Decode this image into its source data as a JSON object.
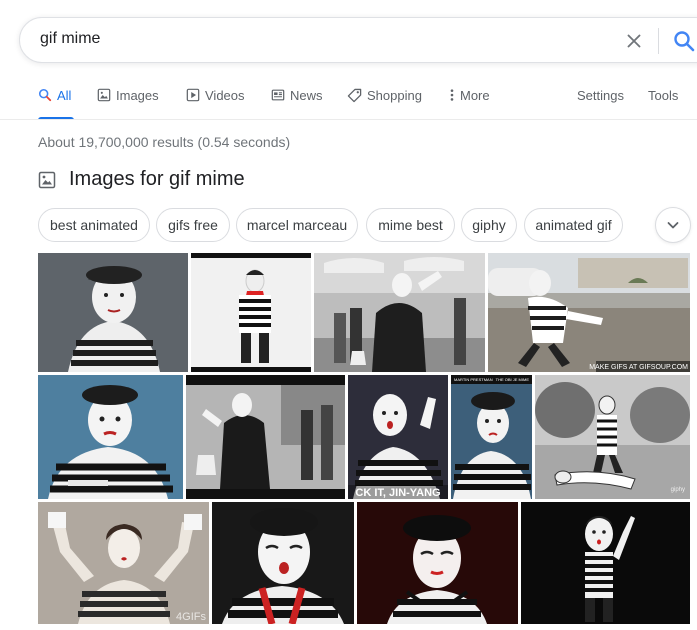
{
  "search": {
    "query": "gif mime"
  },
  "tabs": [
    {
      "label": "All"
    },
    {
      "label": "Images"
    },
    {
      "label": "Videos"
    },
    {
      "label": "News"
    },
    {
      "label": "Shopping"
    },
    {
      "label": "More"
    },
    {
      "label": "Settings"
    },
    {
      "label": "Tools"
    }
  ],
  "result_stats": "About 19,700,000 results (0.54 seconds)",
  "images_section": {
    "title": "Images for gif mime"
  },
  "chips": [
    {
      "label": "best animated"
    },
    {
      "label": "gifs free"
    },
    {
      "label": "marcel marceau"
    },
    {
      "label": "mime best"
    },
    {
      "label": "giphy"
    },
    {
      "label": "animated gif"
    }
  ],
  "thumbnail_captions": {
    "gifsoup": "MAKE GIFS AT GIFSOUP.COM",
    "jinyang": "CK IT, JIN-YANG",
    "meme_top_left": "MARTIN PRESTMAN",
    "meme_top_right": "THE OBI JE MIME",
    "fourgif": "4GIFs"
  },
  "colors": {
    "accent": "#1a73e8",
    "text_secondary": "#5f6368",
    "border": "#dadce0"
  }
}
